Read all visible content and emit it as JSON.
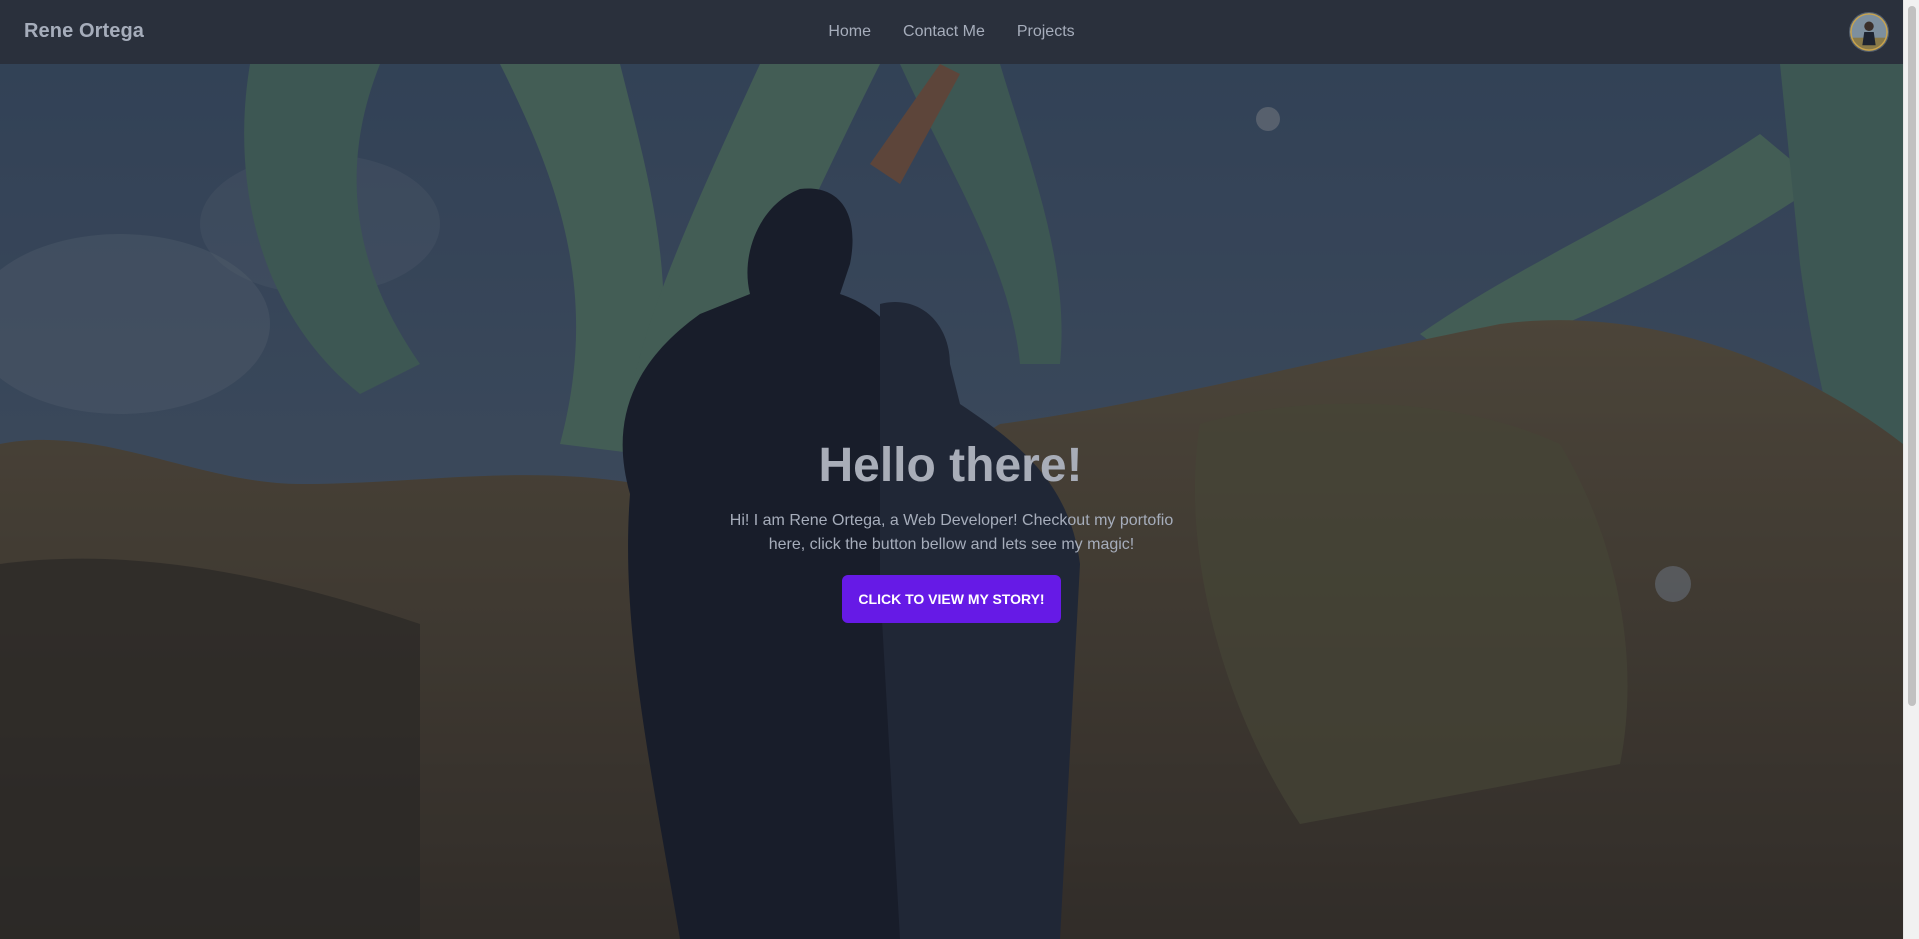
{
  "navbar": {
    "brand": "Rene Ortega",
    "links": [
      {
        "label": "Home"
      },
      {
        "label": "Contact Me"
      },
      {
        "label": "Projects"
      }
    ]
  },
  "hero": {
    "title": "Hello there!",
    "description": "Hi! I am Rene Ortega, a Web Developer! Checkout my portofio here, click the button bellow and lets see my magic!",
    "button_label": "Click to view my story!"
  },
  "colors": {
    "navbar_bg": "#2a303c",
    "text": "#a6adbb",
    "accent": "#661ae6"
  }
}
